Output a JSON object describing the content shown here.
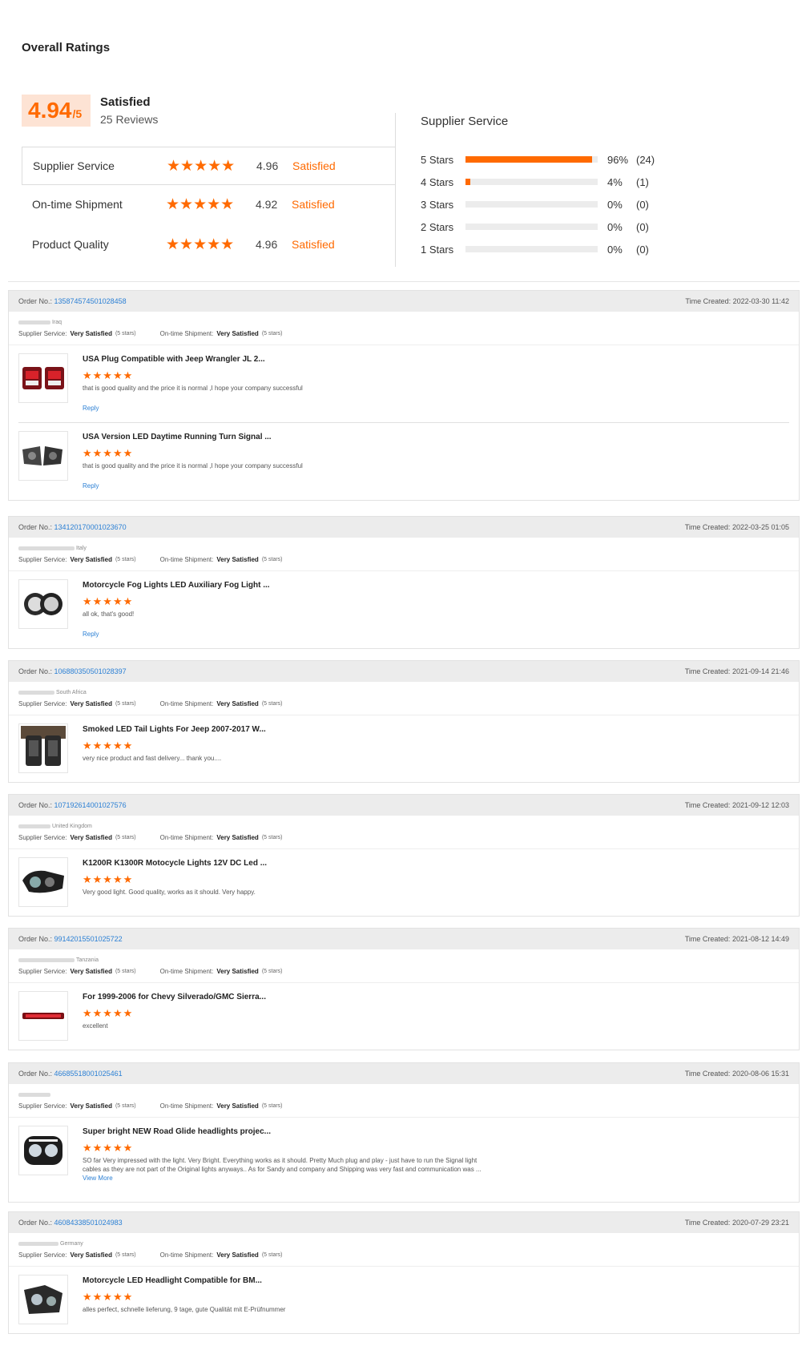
{
  "title": "Overall Ratings",
  "summary": {
    "score": "4.94",
    "out_of": "/5",
    "label": "Satisfied",
    "reviews": "25 Reviews"
  },
  "ratings": [
    {
      "label": "Supplier Service",
      "stars": "★★★★★",
      "score": "4.96",
      "text": "Satisfied"
    },
    {
      "label": "On-time Shipment",
      "stars": "★★★★★",
      "score": "4.92",
      "text": "Satisfied"
    },
    {
      "label": "Product Quality",
      "stars": "★★★★★",
      "score": "4.96",
      "text": "Satisfied"
    }
  ],
  "distribution": {
    "title": "Supplier Service",
    "rows": [
      {
        "label": "5 Stars",
        "fraction": 0.96,
        "pct": "96%",
        "count": "(24)"
      },
      {
        "label": "4 Stars",
        "fraction": 0.04,
        "pct": "4%",
        "count": "(1)"
      },
      {
        "label": "3 Stars",
        "fraction": 0,
        "pct": "0%",
        "count": "(0)"
      },
      {
        "label": "2 Stars",
        "fraction": 0,
        "pct": "0%",
        "count": "(0)"
      },
      {
        "label": "1 Stars",
        "fraction": 0,
        "pct": "0%",
        "count": "(0)"
      }
    ]
  },
  "labels": {
    "order_no": "Order No.: ",
    "time_created": "Time Created: ",
    "supplier_service": "Supplier Service: ",
    "ontime": "On-time Shipment: ",
    "very_satisfied": "Very Satisfied",
    "five_stars": "(5 stars)",
    "reply": "Reply",
    "view_more": "View More",
    "stars": "★★★★★"
  },
  "reviews": [
    {
      "order": "135874574501028458",
      "time": "2022-03-30 11:42",
      "country": "Iraq",
      "products": [
        {
          "title": "USA Plug Compatible with Jeep Wrangler JL 2...",
          "text": "that is good quality and the price it is normal ,I hope your company successful",
          "reply": true,
          "icon": "tail-lights-icon"
        },
        {
          "title": "USA Version LED Daytime Running Turn Signal ...",
          "text": "that is good quality and the price it is normal ,I hope your company successful",
          "reply": true,
          "icon": "turn-signal-icon"
        }
      ]
    },
    {
      "order": "134120170001023670",
      "time": "2022-03-25 01:05",
      "country": "Italy",
      "products": [
        {
          "title": "Motorcycle Fog Lights LED Auxiliary Fog Light ...",
          "text": "all ok, that's good!",
          "reply": true,
          "icon": "fog-light-icon"
        }
      ]
    },
    {
      "order": "106880350501028397",
      "time": "2021-09-14 21:46",
      "country": "South Africa",
      "products": [
        {
          "title": "Smoked LED Tail Lights For Jeep 2007-2017 W...",
          "text": "very nice product and fast delivery... thank you....",
          "reply": false,
          "icon": "smoked-tail-light-icon"
        }
      ]
    },
    {
      "order": "107192614001027576",
      "time": "2021-09-12 12:03",
      "country": "United Kingdom",
      "products": [
        {
          "title": "K1200R K1300R Motocycle Lights 12V DC Led ...",
          "text": "Very good light. Good quality, works as it should. Very happy.",
          "reply": false,
          "icon": "motorcycle-headlight-icon"
        }
      ]
    },
    {
      "order": "99142015501025722",
      "time": "2021-08-12 14:49",
      "country": "Tanzania",
      "products": [
        {
          "title": "For 1999-2006 for Chevy Silverado/GMC Sierra...",
          "text": "excellent",
          "reply": false,
          "icon": "brake-light-bar-icon"
        }
      ]
    },
    {
      "order": "46685518001025461",
      "time": "2020-08-06 15:31",
      "country": "",
      "products": [
        {
          "title": "Super bright NEW Road Glide headlights projec...",
          "text": "SO far Very impressed with the light. Very Bright. Everything works as it should. Pretty Much plug and play - just have to run the Signal light cables as they are not part of the Original lights anyways.. As for Sandy and company and  Shipping was very fast and communication was ...",
          "more": true,
          "reply": false,
          "icon": "road-glide-headlight-icon"
        }
      ]
    },
    {
      "order": "46084338501024983",
      "time": "2020-07-29 23:21",
      "country": "Germany",
      "products": [
        {
          "title": "Motorcycle LED Headlight Compatible for BM...",
          "text": "alles perfect, schnelle lieferung, 9 tage, gute Qualität mit E-Prüfnummer",
          "reply": false,
          "icon": "bmw-headlight-icon"
        }
      ]
    }
  ]
}
